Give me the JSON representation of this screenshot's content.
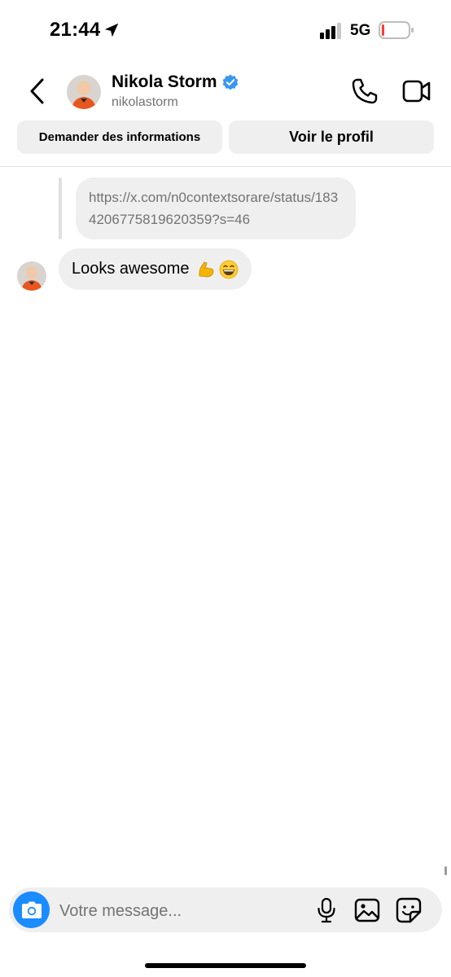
{
  "status_bar": {
    "time": "21:44",
    "network": "5G",
    "battery_color": "#ff3b30"
  },
  "header": {
    "name": "Nikola Storm",
    "handle": "nikolastorm",
    "verified": true,
    "verified_color": "#3897f0"
  },
  "actions": {
    "info_label": "Demander des informations",
    "profile_label": "Voir le profil"
  },
  "messages": {
    "reply_preview": "https://x.com/n0contextsorare/status/1834206775819620359?s=46",
    "text": "Looks awesome",
    "emojis": [
      "flexed-biceps",
      "grinning-face"
    ]
  },
  "composer": {
    "placeholder": "Votre message...",
    "accent": "#1a8cff"
  }
}
